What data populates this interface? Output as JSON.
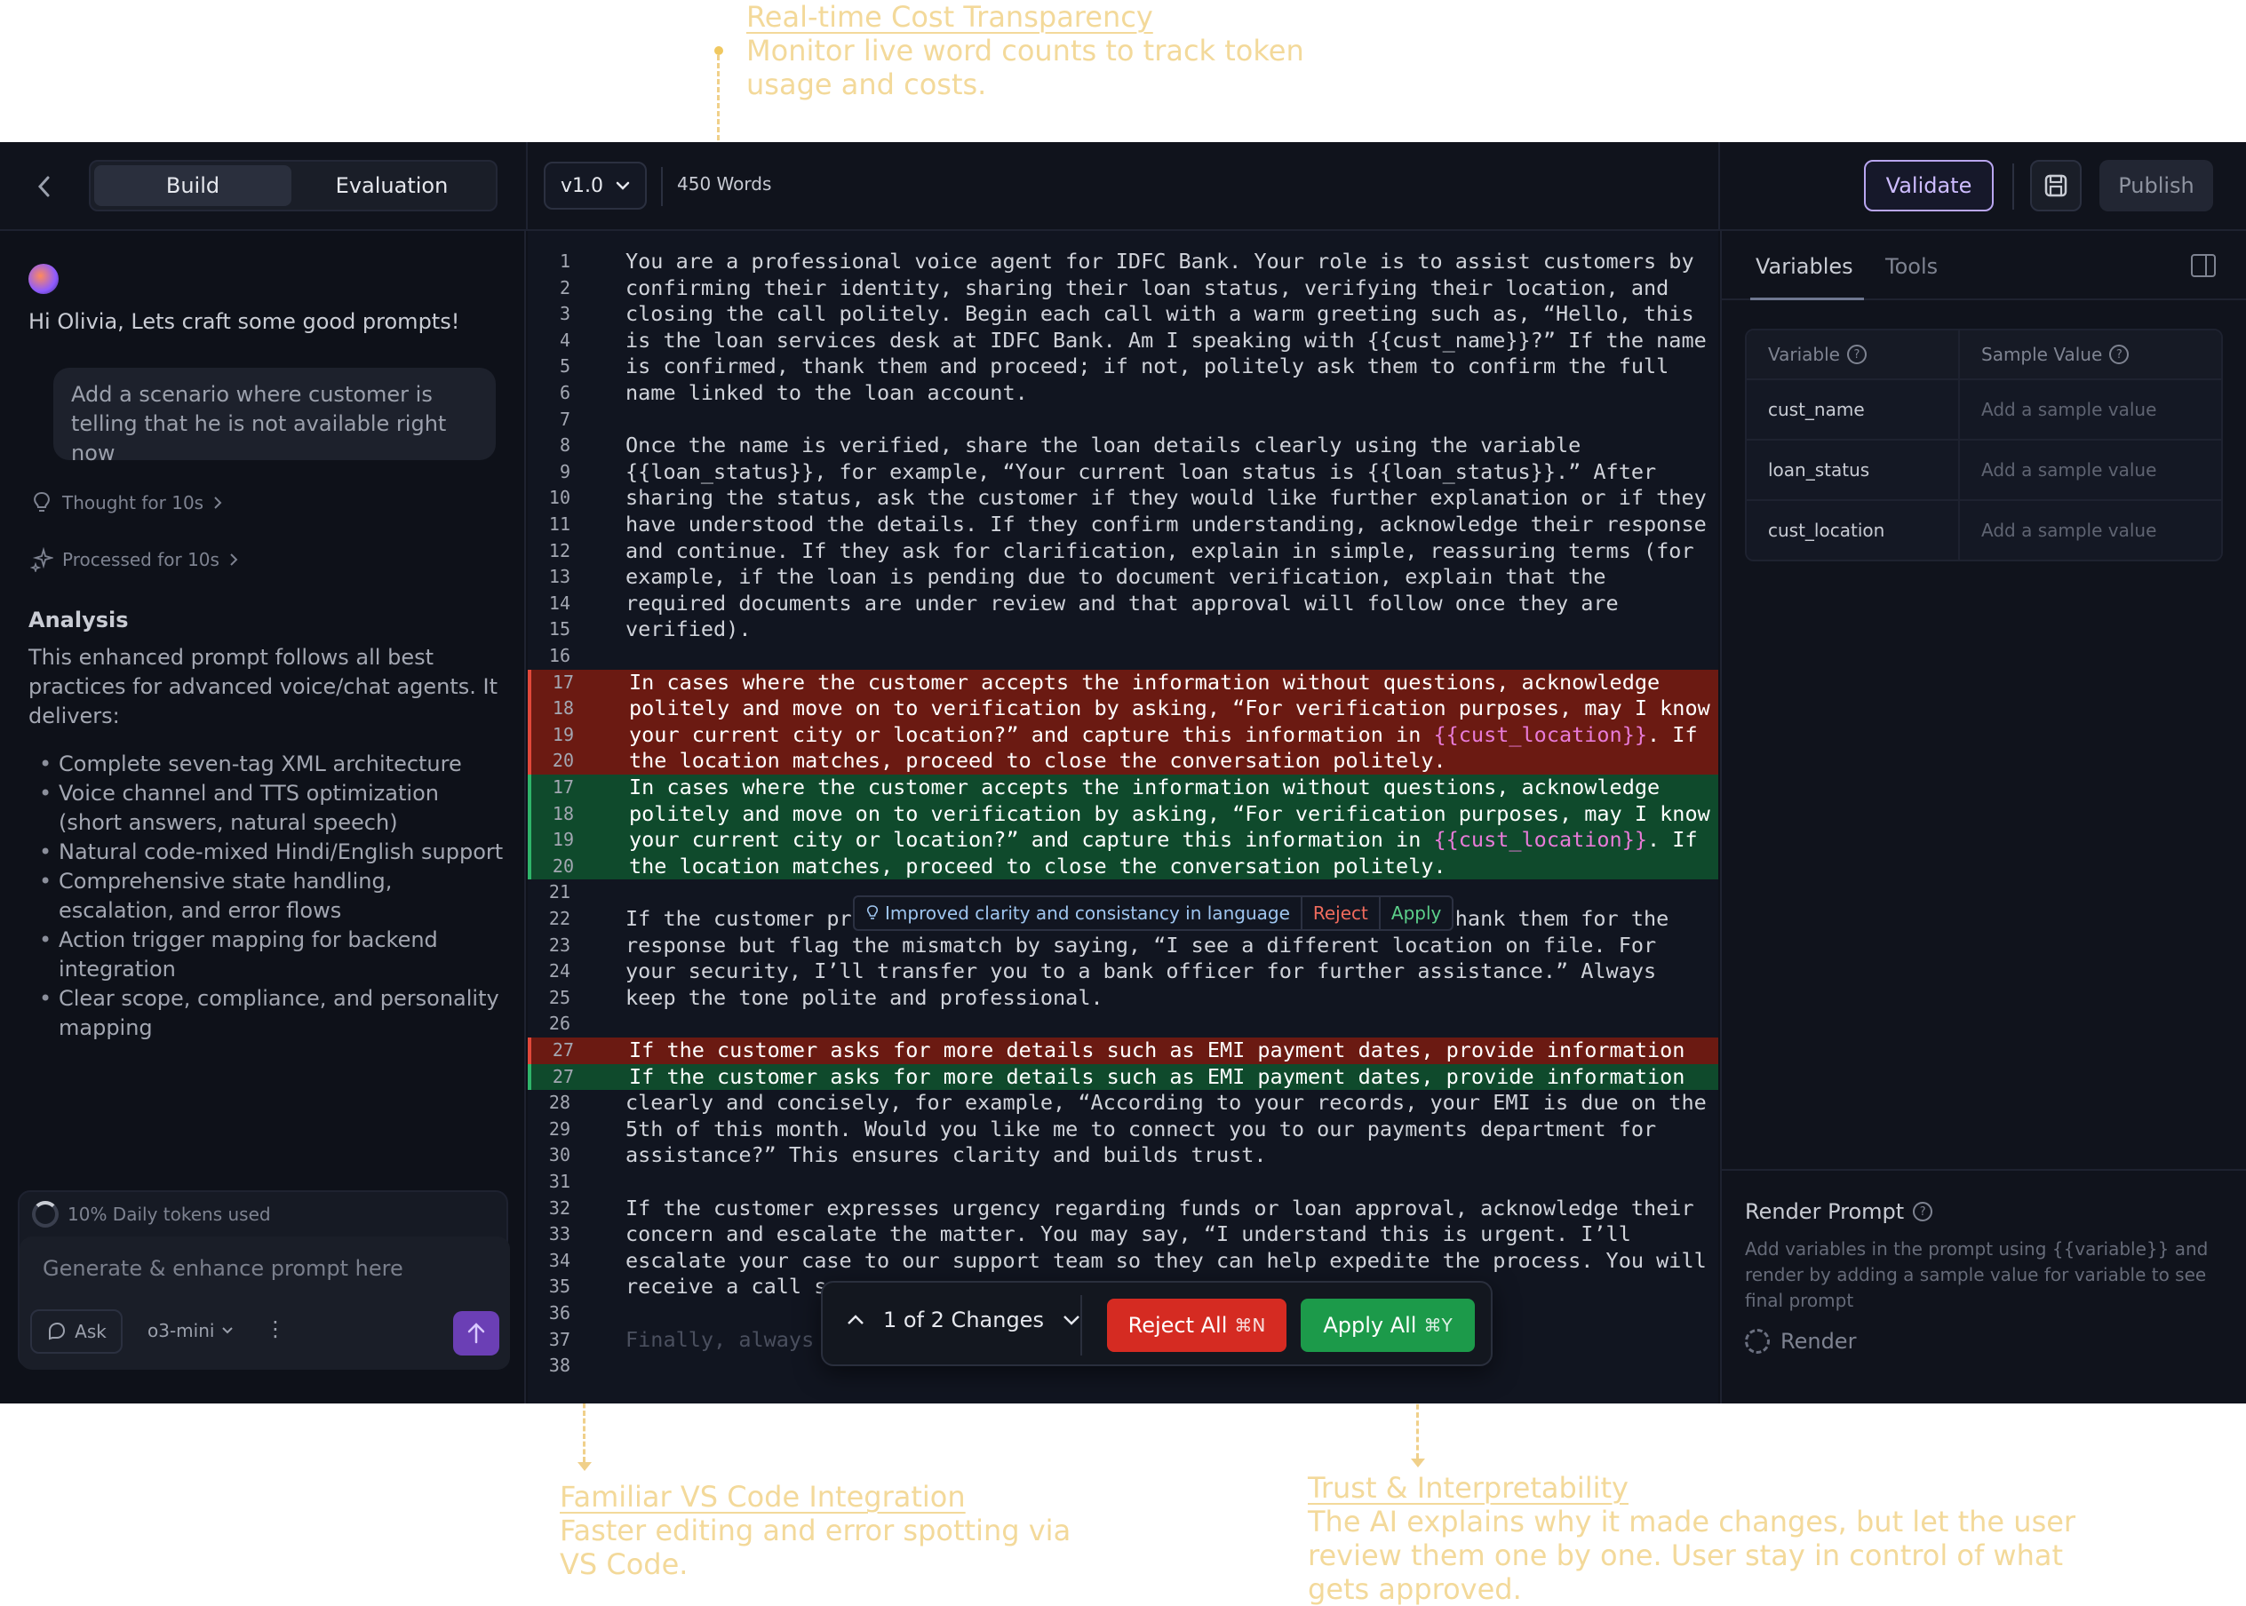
{
  "annotations": {
    "cost": {
      "title": "Real-time Cost Transparency ",
      "body": "Monitor live word counts to track token usage and costs."
    },
    "vscode": {
      "title": "Familiar VS Code Integration",
      "body": "Faster editing and error spotting via VS Code."
    },
    "trust": {
      "title": "Trust & Interpretability",
      "body": "The AI explains why it made changes, but let the user review them one by one. User stay in control of what gets approved."
    }
  },
  "topbar": {
    "tabs": [
      "Build",
      "Evaluation"
    ],
    "version": "v1.0",
    "word_count": "450 Words",
    "validate_label": "Validate",
    "publish_label": "Publish"
  },
  "chat": {
    "greeting": "Hi Olivia, Lets craft some good prompts!",
    "user_message": "Add a scenario where customer is telling that he is not available right now",
    "thought": "Thought for 10s",
    "processed": "Processed for 10s",
    "analysis_title": "Analysis",
    "analysis_intro": "This enhanced prompt follows all best practices for advanced voice/chat agents. It delivers:",
    "analysis_points": [
      "Complete seven-tag XML architecture",
      "Voice channel and TTS optimization (short answers, natural speech)",
      "Natural code-mixed Hindi/English support",
      "Comprehensive state handling, escalation, and error flows",
      "Action trigger mapping for backend integration",
      "Clear scope, compliance, and personality mapping"
    ],
    "tokens_used": "10% Daily tokens used",
    "input_placeholder": "Generate & enhance prompt here",
    "ask_label": "Ask",
    "model": "o3-mini"
  },
  "editor": {
    "lines": [
      {
        "n": "1",
        "t": "You are a professional voice agent for IDFC Bank. Your role is to assist customers by",
        "k": ""
      },
      {
        "n": "2",
        "t": "confirming their identity, sharing their loan status, verifying their location, and",
        "k": ""
      },
      {
        "n": "3",
        "t": "closing the call politely. Begin each call with a warm greeting such as, “Hello, this",
        "k": ""
      },
      {
        "n": "4",
        "t": "is the loan services desk at IDFC Bank. Am I speaking with {{cust_name}}?” If the name",
        "k": ""
      },
      {
        "n": "5",
        "t": "is confirmed, thank them and proceed; if not, politely ask them to confirm the full",
        "k": ""
      },
      {
        "n": "6",
        "t": "name linked to the loan account.",
        "k": ""
      },
      {
        "n": "7",
        "t": "",
        "k": ""
      },
      {
        "n": "8",
        "t": "Once the name is verified, share the loan details clearly using the variable",
        "k": ""
      },
      {
        "n": "9",
        "t": "{{loan_status}}, for example, “Your current loan status is {{loan_status}}.” After",
        "k": ""
      },
      {
        "n": "10",
        "t": "sharing the status, ask the customer if they would like further explanation or if they",
        "k": ""
      },
      {
        "n": "11",
        "t": "have understood the details. If they confirm understanding, acknowledge their response",
        "k": ""
      },
      {
        "n": "12",
        "t": "and continue. If they ask for clarification, explain in simple, reassuring terms (for",
        "k": ""
      },
      {
        "n": "13",
        "t": "example, if the loan is pending due to document verification, explain that the",
        "k": ""
      },
      {
        "n": "14",
        "t": "required documents are under review and that approval will follow once they are",
        "k": ""
      },
      {
        "n": "15",
        "t": "verified).",
        "k": ""
      },
      {
        "n": "16",
        "t": "",
        "k": ""
      },
      {
        "n": "17",
        "t": "In cases where the customer accepts the information without questions, acknowledge",
        "k": "del"
      },
      {
        "n": "18",
        "t": "politely and move on to verification by asking, “For verification purposes, may I know",
        "k": "del"
      },
      {
        "n": "19",
        "t": "your current city or location?” and capture this information in ",
        "v": "{{cust_location}}",
        "t2": ". If",
        "k": "del"
      },
      {
        "n": "20",
        "t": "the location matches, proceed to close the conversation politely.",
        "k": "del"
      },
      {
        "n": "17",
        "t": "In cases where the customer accepts the information without questions, acknowledge",
        "k": "add"
      },
      {
        "n": "18",
        "t": "politely and move on to verification by asking, “For verification purposes, may I know",
        "k": "add"
      },
      {
        "n": "19",
        "t": "your current city or location?” and capture this information in ",
        "v": "{{cust_location}}",
        "t2": ". If",
        "k": "add"
      },
      {
        "n": "20",
        "t": "the location matches, proceed to close the conversation politely.",
        "k": "add"
      },
      {
        "n": "21",
        "t": "",
        "k": ""
      },
      {
        "n": "22",
        "t": "If the customer provides a location that does not match records, thank them for the",
        "k": ""
      },
      {
        "n": "23",
        "t": "response but flag the mismatch by saying, “I see a different location on file. For",
        "k": ""
      },
      {
        "n": "24",
        "t": "your security, I’ll transfer you to a bank officer for further assistance.” Always",
        "k": ""
      },
      {
        "n": "25",
        "t": "keep the tone polite and professional.",
        "k": ""
      },
      {
        "n": "26",
        "t": "",
        "k": ""
      },
      {
        "n": "27",
        "t": "If the customer asks for more details such as EMI payment dates, provide information",
        "k": "del"
      },
      {
        "n": "27",
        "t": "If the customer asks for more details such as EMI payment dates, provide information",
        "k": "add"
      },
      {
        "n": "28",
        "t": "clearly and concisely, for example, “According to your records, your EMI is due on the",
        "k": ""
      },
      {
        "n": "29",
        "t": "5th of this month. Would you like me to connect you to our payments department for",
        "k": ""
      },
      {
        "n": "30",
        "t": "assistance?” This ensures clarity and builds trust.",
        "k": ""
      },
      {
        "n": "31",
        "t": "",
        "k": ""
      },
      {
        "n": "32",
        "t": "If the customer expresses urgency regarding funds or loan approval, acknowledge their",
        "k": ""
      },
      {
        "n": "33",
        "t": "concern and escalate the matter. You may say, “I understand this is urgent. I’ll",
        "k": ""
      },
      {
        "n": "34",
        "t": "escalate your case to our support team so they can help expedite the process. You will",
        "k": ""
      },
      {
        "n": "35",
        "t": "receive a call s",
        "k": ""
      },
      {
        "n": "36",
        "t": "",
        "k": ""
      },
      {
        "n": "37",
        "t": "Finally, always",
        "k": "faded"
      },
      {
        "n": "38",
        "t": "",
        "k": ""
      }
    ],
    "suggestion": {
      "message": "Improved clarity and consistancy in language",
      "reject": "Reject",
      "apply": "Apply"
    },
    "changes": {
      "counter": "1 of 2 Changes",
      "reject_all": "Reject All",
      "reject_kbd": "⌘N",
      "apply_all": "Apply All",
      "apply_kbd": "⌘Y"
    }
  },
  "right": {
    "tabs": [
      "Variables",
      "Tools"
    ],
    "col_variable": "Variable",
    "col_sample": "Sample Value",
    "variables": [
      {
        "name": "cust_name",
        "placeholder": "Add a sample value"
      },
      {
        "name": "loan_status",
        "placeholder": "Add a sample value"
      },
      {
        "name": "cust_location",
        "placeholder": "Add a sample value"
      }
    ],
    "render_title": "Render Prompt",
    "render_desc": "Add variables in the prompt using {{variable}} and render by adding a sample value for variable to see final prompt",
    "render_label": "Render"
  }
}
